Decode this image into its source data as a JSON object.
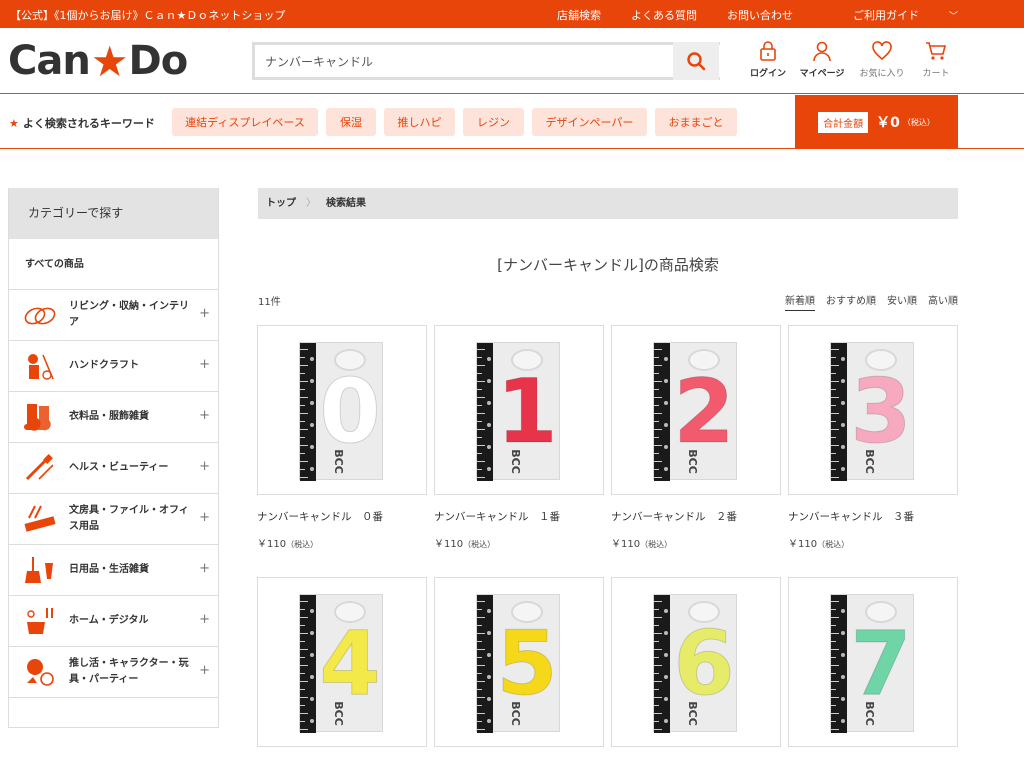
{
  "topbar": {
    "promo": "【公式】《1個からお届け》Ｃａｎ★Ｄｏネットショップ",
    "links": [
      "店舗検索",
      "よくある質問",
      "お問い合わせ",
      "ご利用ガイド"
    ]
  },
  "header": {
    "logo": {
      "left": "Can",
      "star": "★",
      "right": "Do"
    },
    "search_value": "ナンバーキャンドル",
    "icons": {
      "login": "ログイン",
      "mypage": "マイページ",
      "favorites": "お気に入り",
      "cart": "カート"
    }
  },
  "keywords": {
    "label": "よく検索されるキーワード",
    "items": [
      "連結ディスプレイベース",
      "保湿",
      "推しハピ",
      "レジン",
      "デザインペーパー",
      "おままごと"
    ],
    "total_label": "合計金額",
    "total_value": "￥0",
    "total_tax": "（税込）"
  },
  "sidebar": {
    "title": "カテゴリーで探す",
    "all": "すべての商品",
    "categories": [
      {
        "label": "リビング・収納・インテリア",
        "icon": "living-icon"
      },
      {
        "label": "ハンドクラフト",
        "icon": "handcraft-icon"
      },
      {
        "label": "衣料品・服飾雑貨",
        "icon": "clothing-icon"
      },
      {
        "label": "ヘルス・ビューティー",
        "icon": "beauty-icon"
      },
      {
        "label": "文房具・ファイル・オフィス用品",
        "icon": "stationery-icon"
      },
      {
        "label": "日用品・生活雑貨",
        "icon": "daily-goods-icon"
      },
      {
        "label": "ホーム・デジタル",
        "icon": "home-digital-icon"
      },
      {
        "label": "推し活・キャラクター・玩具・パーティー",
        "icon": "oshi-icon"
      }
    ]
  },
  "breadcrumb": {
    "home": "トップ",
    "current": "検索結果"
  },
  "results": {
    "title": "[ナンバーキャンドル]の商品検索",
    "count": "11件",
    "sorts": [
      "新着順",
      "おすすめ順",
      "安い順",
      "高い順"
    ],
    "active_sort": "新着順",
    "products": [
      {
        "name": "ナンバーキャンドル　０番",
        "price": "￥110",
        "tax": "（税込）",
        "digit": "0",
        "color": "#ffffff"
      },
      {
        "name": "ナンバーキャンドル　１番",
        "price": "￥110",
        "tax": "（税込）",
        "digit": "1",
        "color": "#e8344a"
      },
      {
        "name": "ナンバーキャンドル　２番",
        "price": "￥110",
        "tax": "（税込）",
        "digit": "2",
        "color": "#f25a6e"
      },
      {
        "name": "ナンバーキャンドル　３番",
        "price": "￥110",
        "tax": "（税込）",
        "digit": "3",
        "color": "#f7a9bf"
      },
      {
        "name": "",
        "price": "",
        "tax": "",
        "digit": "4",
        "color": "#f3ea4a"
      },
      {
        "name": "",
        "price": "",
        "tax": "",
        "digit": "5",
        "color": "#f5d81a"
      },
      {
        "name": "",
        "price": "",
        "tax": "",
        "digit": "6",
        "color": "#e6ec6a"
      },
      {
        "name": "",
        "price": "",
        "tax": "",
        "digit": "7",
        "color": "#6fd4a6"
      }
    ]
  },
  "colors": {
    "brand": "#e8450a",
    "chip_bg": "#fde3da"
  }
}
